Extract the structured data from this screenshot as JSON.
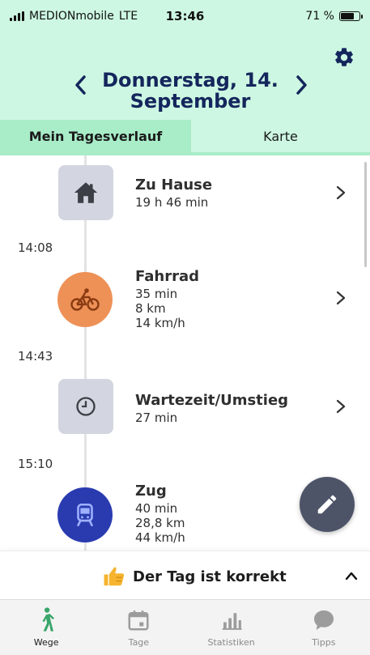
{
  "status_bar": {
    "carrier": "MEDIONmobile",
    "network": "LTE",
    "time": "13:46",
    "battery": "71 %"
  },
  "header": {
    "date": "Donnerstag, 14. September"
  },
  "tabs": [
    {
      "label": "Mein Tagesverlauf",
      "active": true
    },
    {
      "label": "Karte",
      "active": false
    }
  ],
  "timeline": {
    "entries": [
      {
        "title": "Zu Hause",
        "details": [
          "19 h 46 min"
        ],
        "icon": "house-icon"
      },
      {
        "start_time": "14:08",
        "title": "Fahrrad",
        "details": [
          "35 min",
          "8 km",
          "14 km/h"
        ],
        "icon": "bicycle-icon"
      },
      {
        "start_time": "14:43",
        "title": "Wartezeit/Umstieg",
        "details": [
          "27 min"
        ],
        "icon": "clock-icon"
      },
      {
        "start_time": "15:10",
        "title": "Zug",
        "details": [
          "40 min",
          "28,8 km",
          "44 km/h"
        ],
        "icon": "train-icon"
      }
    ]
  },
  "confirm_bar": {
    "label": "Der Tag ist korrekt",
    "icon": "thumbs-up-icon"
  },
  "bottom_nav": [
    {
      "label": "Wege",
      "icon": "walking-icon",
      "active": true
    },
    {
      "label": "Tage",
      "icon": "calendar-icon",
      "active": false
    },
    {
      "label": "Statistiken",
      "icon": "bar-chart-icon",
      "active": false
    },
    {
      "label": "Tipps",
      "icon": "speech-bubble-icon",
      "active": false
    }
  ],
  "colors": {
    "header_bg": "#cdf7e2",
    "active_tab": "#a8ecc8",
    "title_text": "#14265c",
    "bike": "#ee9157",
    "train": "#2a3bb0",
    "fab": "#4e5468",
    "active_nav": "#3aa56a"
  }
}
